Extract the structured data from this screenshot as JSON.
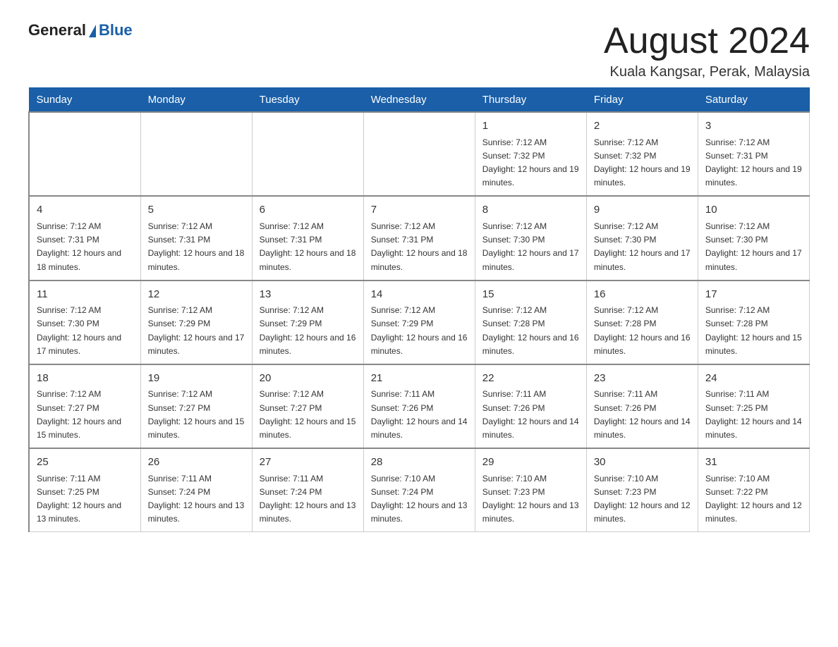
{
  "header": {
    "logo_general": "General",
    "logo_blue": "Blue",
    "title": "August 2024",
    "subtitle": "Kuala Kangsar, Perak, Malaysia"
  },
  "weekdays": [
    "Sunday",
    "Monday",
    "Tuesday",
    "Wednesday",
    "Thursday",
    "Friday",
    "Saturday"
  ],
  "weeks": [
    [
      {
        "day": "",
        "info": ""
      },
      {
        "day": "",
        "info": ""
      },
      {
        "day": "",
        "info": ""
      },
      {
        "day": "",
        "info": ""
      },
      {
        "day": "1",
        "info": "Sunrise: 7:12 AM\nSunset: 7:32 PM\nDaylight: 12 hours and 19 minutes."
      },
      {
        "day": "2",
        "info": "Sunrise: 7:12 AM\nSunset: 7:32 PM\nDaylight: 12 hours and 19 minutes."
      },
      {
        "day": "3",
        "info": "Sunrise: 7:12 AM\nSunset: 7:31 PM\nDaylight: 12 hours and 19 minutes."
      }
    ],
    [
      {
        "day": "4",
        "info": "Sunrise: 7:12 AM\nSunset: 7:31 PM\nDaylight: 12 hours and 18 minutes."
      },
      {
        "day": "5",
        "info": "Sunrise: 7:12 AM\nSunset: 7:31 PM\nDaylight: 12 hours and 18 minutes."
      },
      {
        "day": "6",
        "info": "Sunrise: 7:12 AM\nSunset: 7:31 PM\nDaylight: 12 hours and 18 minutes."
      },
      {
        "day": "7",
        "info": "Sunrise: 7:12 AM\nSunset: 7:31 PM\nDaylight: 12 hours and 18 minutes."
      },
      {
        "day": "8",
        "info": "Sunrise: 7:12 AM\nSunset: 7:30 PM\nDaylight: 12 hours and 17 minutes."
      },
      {
        "day": "9",
        "info": "Sunrise: 7:12 AM\nSunset: 7:30 PM\nDaylight: 12 hours and 17 minutes."
      },
      {
        "day": "10",
        "info": "Sunrise: 7:12 AM\nSunset: 7:30 PM\nDaylight: 12 hours and 17 minutes."
      }
    ],
    [
      {
        "day": "11",
        "info": "Sunrise: 7:12 AM\nSunset: 7:30 PM\nDaylight: 12 hours and 17 minutes."
      },
      {
        "day": "12",
        "info": "Sunrise: 7:12 AM\nSunset: 7:29 PM\nDaylight: 12 hours and 17 minutes."
      },
      {
        "day": "13",
        "info": "Sunrise: 7:12 AM\nSunset: 7:29 PM\nDaylight: 12 hours and 16 minutes."
      },
      {
        "day": "14",
        "info": "Sunrise: 7:12 AM\nSunset: 7:29 PM\nDaylight: 12 hours and 16 minutes."
      },
      {
        "day": "15",
        "info": "Sunrise: 7:12 AM\nSunset: 7:28 PM\nDaylight: 12 hours and 16 minutes."
      },
      {
        "day": "16",
        "info": "Sunrise: 7:12 AM\nSunset: 7:28 PM\nDaylight: 12 hours and 16 minutes."
      },
      {
        "day": "17",
        "info": "Sunrise: 7:12 AM\nSunset: 7:28 PM\nDaylight: 12 hours and 15 minutes."
      }
    ],
    [
      {
        "day": "18",
        "info": "Sunrise: 7:12 AM\nSunset: 7:27 PM\nDaylight: 12 hours and 15 minutes."
      },
      {
        "day": "19",
        "info": "Sunrise: 7:12 AM\nSunset: 7:27 PM\nDaylight: 12 hours and 15 minutes."
      },
      {
        "day": "20",
        "info": "Sunrise: 7:12 AM\nSunset: 7:27 PM\nDaylight: 12 hours and 15 minutes."
      },
      {
        "day": "21",
        "info": "Sunrise: 7:11 AM\nSunset: 7:26 PM\nDaylight: 12 hours and 14 minutes."
      },
      {
        "day": "22",
        "info": "Sunrise: 7:11 AM\nSunset: 7:26 PM\nDaylight: 12 hours and 14 minutes."
      },
      {
        "day": "23",
        "info": "Sunrise: 7:11 AM\nSunset: 7:26 PM\nDaylight: 12 hours and 14 minutes."
      },
      {
        "day": "24",
        "info": "Sunrise: 7:11 AM\nSunset: 7:25 PM\nDaylight: 12 hours and 14 minutes."
      }
    ],
    [
      {
        "day": "25",
        "info": "Sunrise: 7:11 AM\nSunset: 7:25 PM\nDaylight: 12 hours and 13 minutes."
      },
      {
        "day": "26",
        "info": "Sunrise: 7:11 AM\nSunset: 7:24 PM\nDaylight: 12 hours and 13 minutes."
      },
      {
        "day": "27",
        "info": "Sunrise: 7:11 AM\nSunset: 7:24 PM\nDaylight: 12 hours and 13 minutes."
      },
      {
        "day": "28",
        "info": "Sunrise: 7:10 AM\nSunset: 7:24 PM\nDaylight: 12 hours and 13 minutes."
      },
      {
        "day": "29",
        "info": "Sunrise: 7:10 AM\nSunset: 7:23 PM\nDaylight: 12 hours and 13 minutes."
      },
      {
        "day": "30",
        "info": "Sunrise: 7:10 AM\nSunset: 7:23 PM\nDaylight: 12 hours and 12 minutes."
      },
      {
        "day": "31",
        "info": "Sunrise: 7:10 AM\nSunset: 7:22 PM\nDaylight: 12 hours and 12 minutes."
      }
    ]
  ]
}
